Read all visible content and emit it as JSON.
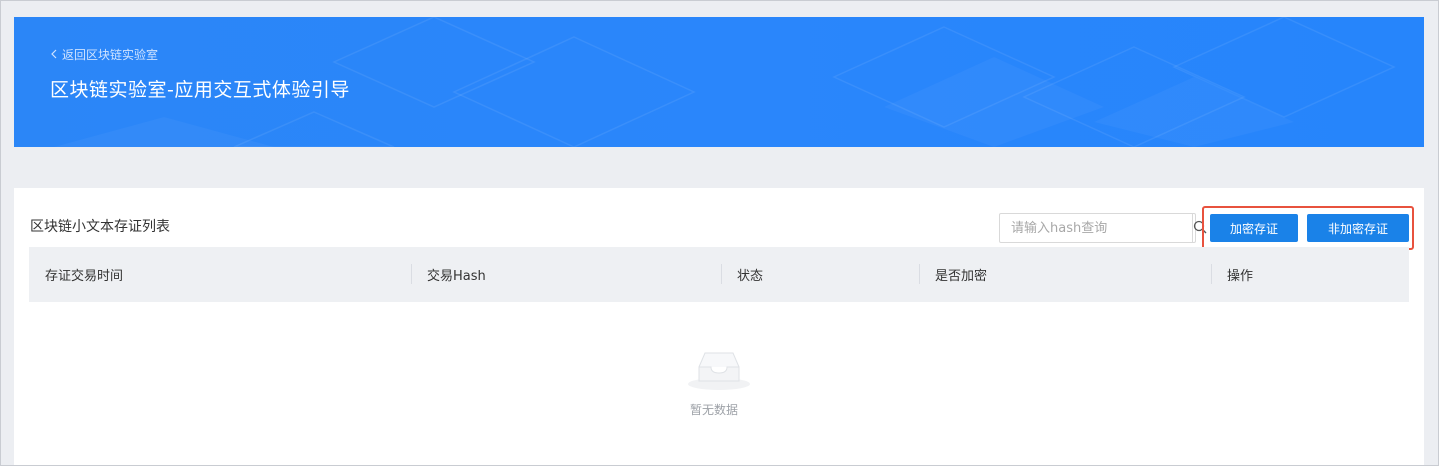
{
  "header": {
    "back_link": "返回区块链实验室",
    "title": "区块链实验室-应用交互式体验引导"
  },
  "panel": {
    "title": "区块链小文本存证列表",
    "search": {
      "placeholder": "请输入hash查询",
      "value": ""
    },
    "buttons": {
      "encrypted": "加密存证",
      "plain": "非加密存证"
    },
    "table": {
      "columns": [
        "存证交易时间",
        "交易Hash",
        "状态",
        "是否加密",
        "操作"
      ],
      "rows": []
    },
    "empty_text": "暂无数据"
  },
  "icons": {
    "back": "chevron-left-icon",
    "search": "search-icon",
    "empty": "empty-inbox-icon"
  },
  "colors": {
    "banner": "#2a86fb",
    "primary_button": "#1a82e8",
    "highlight_border": "#e8523e",
    "table_header": "#eef0f3"
  }
}
